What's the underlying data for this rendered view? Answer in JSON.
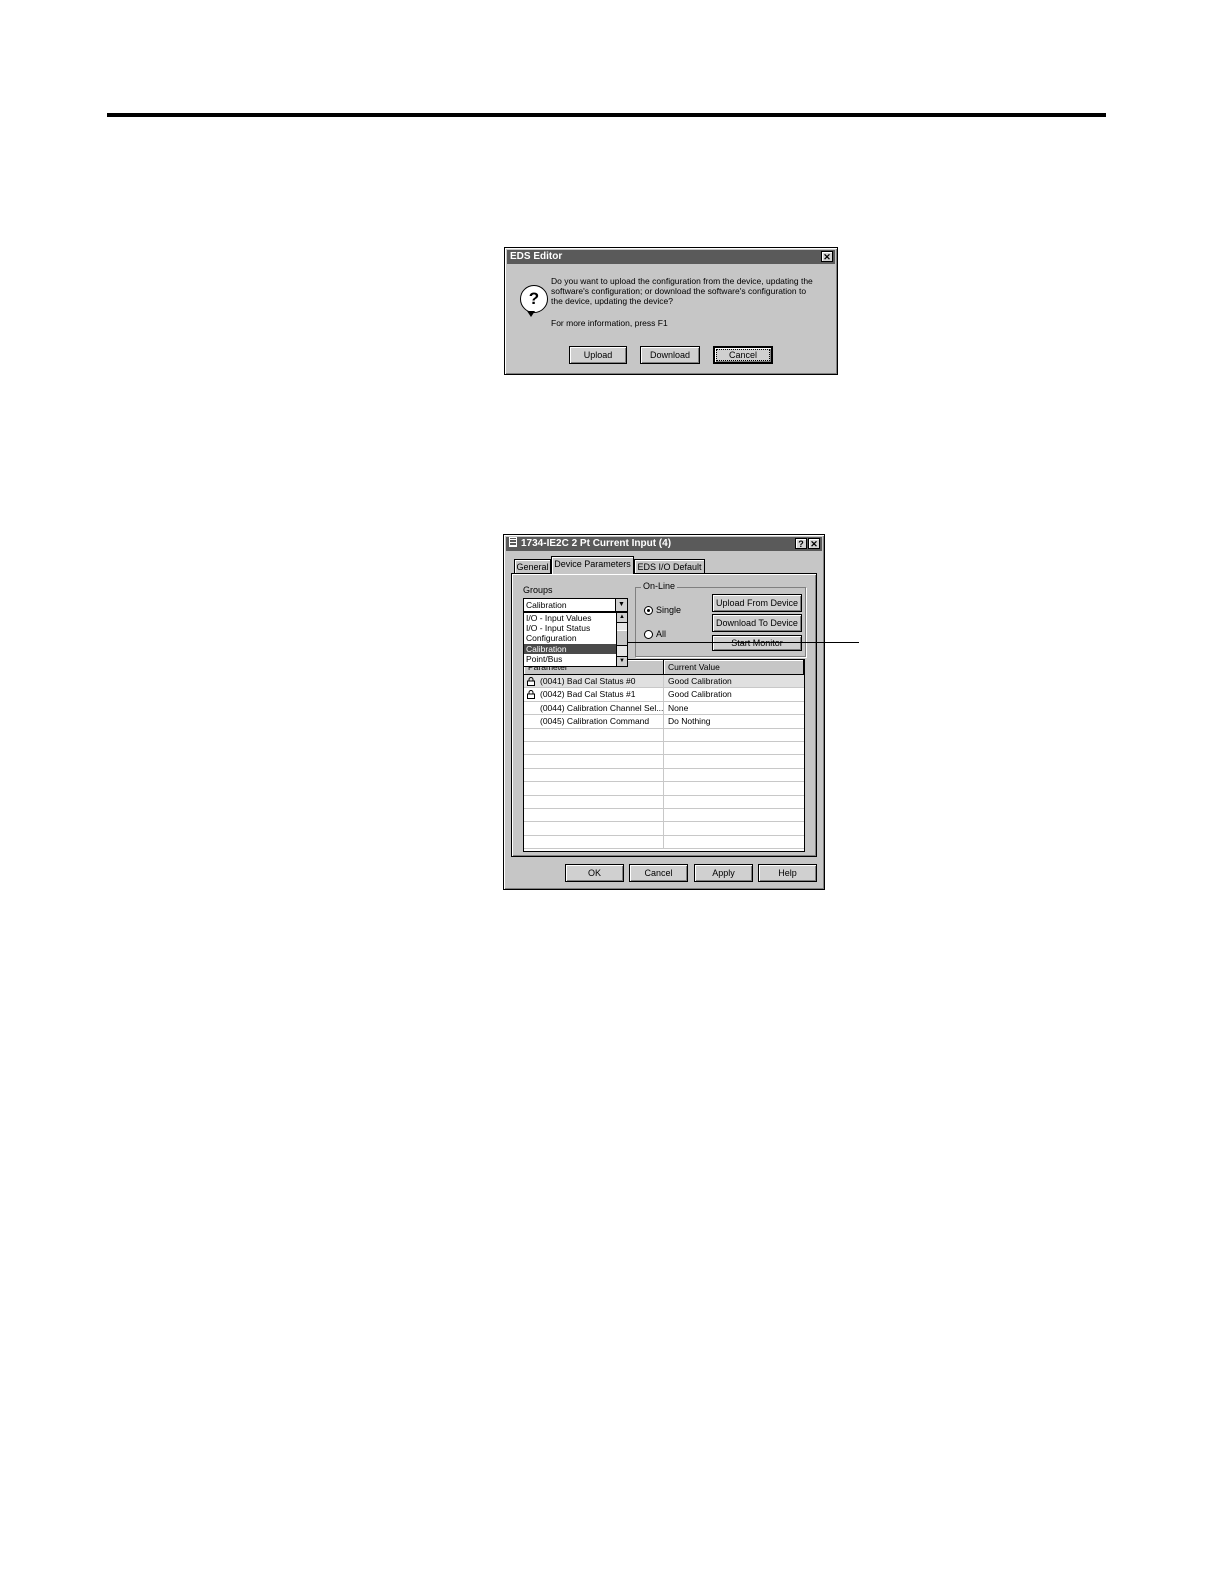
{
  "eds_dialog": {
    "title": "EDS Editor",
    "close_glyph": "✕",
    "message_line1": "Do you want to upload the configuration from the device, updating the",
    "message_line2": "software's configuration; or download the software's configuration to",
    "message_line3": "the device, updating the device?",
    "help_text": "For more information, press F1",
    "buttons": {
      "upload": "Upload",
      "download": "Download",
      "cancel": "Cancel"
    },
    "icon": "question-icon"
  },
  "props_dialog": {
    "title": "1734-IE2C 2 Pt Current Input (4)",
    "help_glyph": "?",
    "close_glyph": "✕",
    "tabs": [
      "General",
      "Device Parameters",
      "EDS I/O Default"
    ],
    "active_tab": "Device Parameters",
    "groups_label": "Groups",
    "groups_selected": "Calibration",
    "groups_options": [
      "I/O - Input Values",
      "I/O - Input Status",
      "Configuration",
      "Calibration",
      "Point/Bus"
    ],
    "online_label": "On-Line",
    "radio_single": "Single",
    "radio_all": "All",
    "selected_radio": "Single",
    "btn_upload_from_device": "Upload From Device",
    "btn_download_to_device": "Download To Device",
    "btn_start_monitor": "Start Monitor",
    "table_headers": [
      "Parameter",
      "Current Value"
    ],
    "rows": [
      {
        "param": "(0041) Bad Cal Status #0",
        "value": "Good Calibration",
        "locked": true
      },
      {
        "param": "(0042) Bad Cal Status #1",
        "value": "Good Calibration",
        "locked": true
      },
      {
        "param": "(0044) Calibration Channel Sel...",
        "value": "None",
        "locked": false
      },
      {
        "param": "(0045) Calibration Command",
        "value": "Do Nothing",
        "locked": false
      }
    ],
    "footer_buttons": {
      "ok": "OK",
      "cancel": "Cancel",
      "apply": "Apply",
      "help": "Help"
    }
  },
  "colors": {
    "dialog_face": "#c6c6c6",
    "titlebar": "#5a5a5a",
    "selection": "#4a4a4a"
  }
}
